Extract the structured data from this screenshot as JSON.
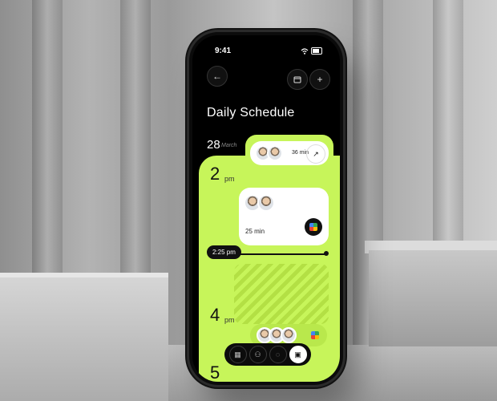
{
  "status": {
    "time": "9:41"
  },
  "header": {
    "title": "Daily Schedule"
  },
  "date": {
    "day": "28",
    "month": "March"
  },
  "events": [
    {
      "duration": "36 min",
      "avatars": 2
    },
    {
      "duration": "25 min",
      "avatars": 2
    },
    {
      "avatars": 3
    }
  ],
  "timeline": {
    "now_label": "2:25 pm"
  },
  "hours": [
    {
      "hour": "2",
      "suffix": "pm"
    },
    {
      "hour": "4",
      "suffix": "pm"
    },
    {
      "hour": "5",
      "suffix": ""
    }
  ],
  "icons": {
    "back": "back-arrow-icon",
    "calendar": "calendar-icon",
    "add": "plus-icon",
    "open": "arrow-up-right-icon",
    "meet": "google-meet-icon"
  },
  "dock": [
    "grid-icon",
    "people-icon",
    "chat-icon",
    "calendar-icon"
  ],
  "colors": {
    "accent": "#c7f55a",
    "background": "#000000"
  }
}
